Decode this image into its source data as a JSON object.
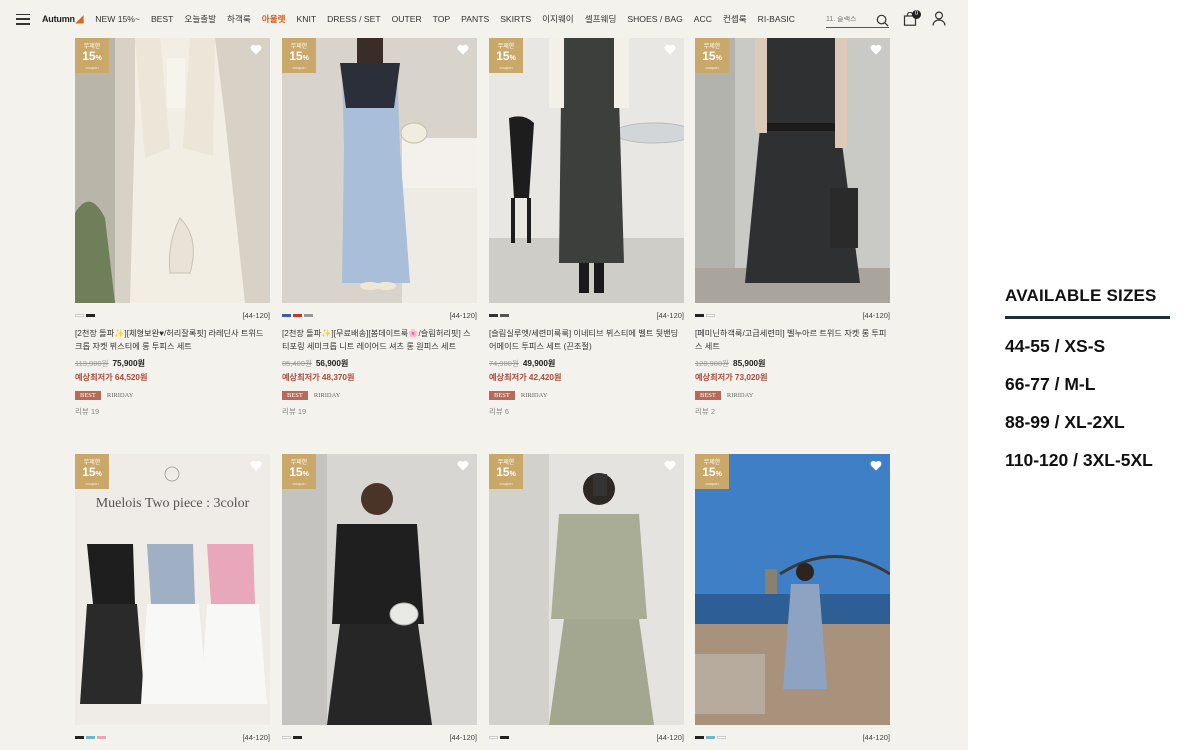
{
  "nav": {
    "logo": "Autumn",
    "items": [
      "NEW 15%~",
      "BEST",
      "오늘출발",
      "하객룩",
      "아울렛",
      "KNIT",
      "DRESS / SET",
      "OUTER",
      "TOP",
      "PANTS",
      "SKIRTS",
      "이지웨이",
      "셀프웨딩",
      "SHOES / BAG",
      "ACC",
      "컨셉룩",
      "RI-BASIC"
    ],
    "active_item": "아울렛",
    "search_placeholder": "11. 슬랙스",
    "cart_count": "0"
  },
  "promo_badge": {
    "top": "무제한",
    "pct": "15",
    "unit": "%",
    "bottom": "coupon"
  },
  "products_row1": [
    {
      "swatches": [
        "#ffffff",
        "#222222"
      ],
      "size_range": "[44-120]",
      "name": "[2천장 돌파✨][체형보완♥/허리잘록핏] 라레딘사 트위드 크롭 자켓 뷔스티에 롱 투피스 세트",
      "original_price": "113,900원",
      "sale_price": "75,900원",
      "expected_price": "예상최저가 64,520원",
      "best_tag": "BEST",
      "brand_tag": "RIRIDAY",
      "review": "리뷰 19"
    },
    {
      "swatches": [
        "#3b5fa8",
        "#c0392b",
        "#999999"
      ],
      "size_range": "[44-120]",
      "name": "[2천장 돌파✨][무료배송][봄데이트룩🌸/슬림허리핏] 스티포링 세미크롭 니트 레이어드 셔츠 롱 원피스 세트",
      "original_price": "85,400원",
      "sale_price": "56,900원",
      "expected_price": "예상최저가 48,370원",
      "best_tag": "BEST",
      "brand_tag": "RIRIDAY",
      "review": "리뷰 19"
    },
    {
      "swatches": [
        "#333333",
        "#555555"
      ],
      "size_range": "[44-120]",
      "name": "[슬림실루엣/세련미룩룩] 이네티브 뷔스티에 벨트 뒷밴딩 어메이드 투피스 세트 (끈조절)",
      "original_price": "74,900원",
      "sale_price": "49,900원",
      "expected_price": "예상최저가 42,420원",
      "best_tag": "BEST",
      "brand_tag": "RIRIDAY",
      "review": "리뷰 6"
    },
    {
      "swatches": [
        "#222222",
        "#ffffff"
      ],
      "size_range": "[44-120]",
      "name": "[페미닌하객룩/고급세련미] 벨누아르 트위드 자켓 롱 투피스 세트",
      "original_price": "128,900원",
      "sale_price": "85,900원",
      "expected_price": "예상최저가 73,020원",
      "best_tag": "BEST",
      "brand_tag": "RIRIDAY",
      "review": "리뷰 2"
    }
  ],
  "products_row2": [
    {
      "swatches": [
        "#222222",
        "#6fb6c9",
        "#e8a5b8"
      ],
      "size_range": "[44-120]",
      "image_title": "Muelois Two piece : 3color"
    },
    {
      "swatches": [
        "#ffffff",
        "#222222"
      ],
      "size_range": "[44-120]"
    },
    {
      "swatches": [
        "#ffffff",
        "#222222"
      ],
      "size_range": "[44-120]"
    },
    {
      "swatches": [
        "#222222",
        "#6fb6c9",
        "#ffffff"
      ],
      "size_range": "[44-120]"
    }
  ],
  "sizes_panel": {
    "title": "AVAILABLE SIZES",
    "lines": [
      "44-55 / XS-S",
      "66-77 / M-L",
      "88-99 / XL-2XL",
      "110-120 / 3XL-5XL"
    ]
  },
  "colors": {
    "accent_nav": "#d25a1a",
    "badge": "#c9a86a",
    "best_tag": "#b56a5a",
    "expected_price": "#a84a3c",
    "panel_rule": "#1e2d3d"
  }
}
